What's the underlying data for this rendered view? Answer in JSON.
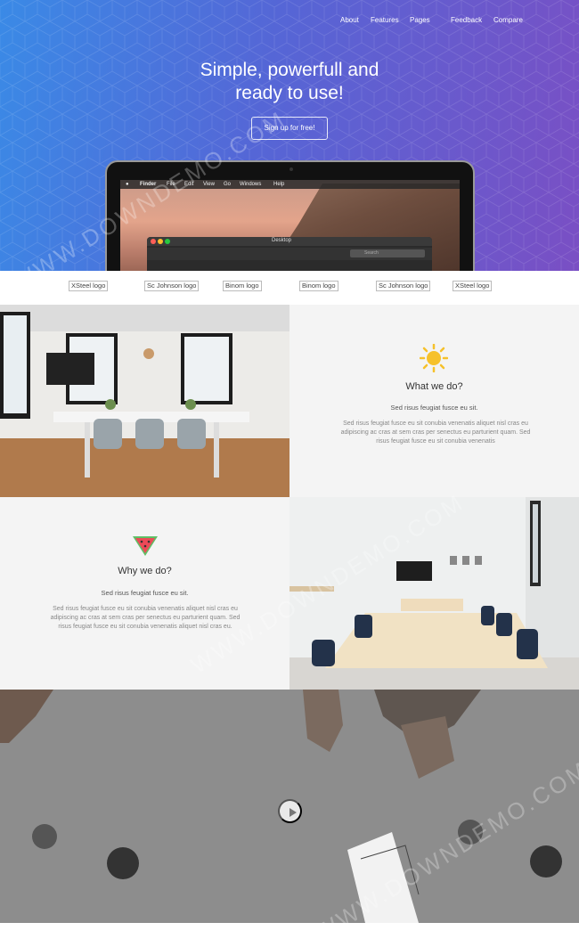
{
  "nav": {
    "items": [
      "About",
      "Features",
      "Pages",
      "Feedback",
      "Compare"
    ]
  },
  "hero": {
    "headline_line1": "Simple, powerfull and",
    "headline_line2": "ready to use!",
    "cta_label": "Sign up for free!"
  },
  "screen": {
    "menu": [
      "Finder",
      "File",
      "Edit",
      "View",
      "Go",
      "Windows",
      "Help"
    ],
    "finder_title": "Desktop",
    "search_placeholder": "Search"
  },
  "logos": [
    "XSteel logo",
    "Sc Johnson logo",
    "Binom logo",
    "Binom logo",
    "Sc Johnson logo",
    "XSteel logo"
  ],
  "features": [
    {
      "icon": "sun-icon",
      "title": "What we do?",
      "subtitle": "Sed risus feugiat fusce eu sit.",
      "body": "Sed risus feugiat fusce eu sit conubia venenatis aliquet nisl cras eu adipiscing ac cras at sem cras per senectus eu parturient quam. Sed risus feugiat fusce eu sit conubia venenatis"
    },
    {
      "icon": "watermelon-icon",
      "title": "Why we do?",
      "subtitle": "Sed risus feugiat fusce eu sit.",
      "body": "Sed risus feugiat fusce eu sit conubia venenatis aliquet nisl cras eu adipiscing ac cras at sem cras per senectus eu parturient quam. Sed risus feugiat fusce eu sit conubia venenatis aliquet nisl cras eu."
    }
  ],
  "watermark": "WWW.DOWNDEMO.COM",
  "colors": {
    "hero_start": "#3a8ae6",
    "hero_end": "#7a4fc4",
    "sun": "#f6c12b",
    "melon_red": "#ec4a57",
    "melon_green": "#5fbf65"
  }
}
